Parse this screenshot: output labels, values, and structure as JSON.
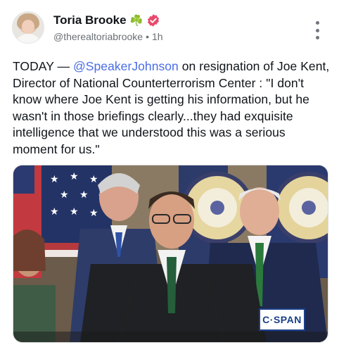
{
  "post": {
    "author_name": "Toria Brooke",
    "author_emoji": "☘️",
    "handle": "@therealtoriabrooke",
    "separator": "•",
    "time_ago": "1h",
    "body_prefix": "TODAY — ",
    "mention": "@SpeakerJohnson",
    "body_text": " on resignation of Joe Kent, Director of National Counterterrorism Center : \"I don't know where Joe Kent is getting his information, but he wasn't in those briefings clearly...they had exquisite intelligence that we understood this was a serious moment for us.\"",
    "media_watermark": "C·SPAN"
  },
  "icons": {
    "verified": "verified-badge-icon",
    "more": "more-options-icon"
  },
  "colors": {
    "mention": "#4a6de5",
    "verified": "#e8496b",
    "watermark": "#1b3f8a"
  }
}
